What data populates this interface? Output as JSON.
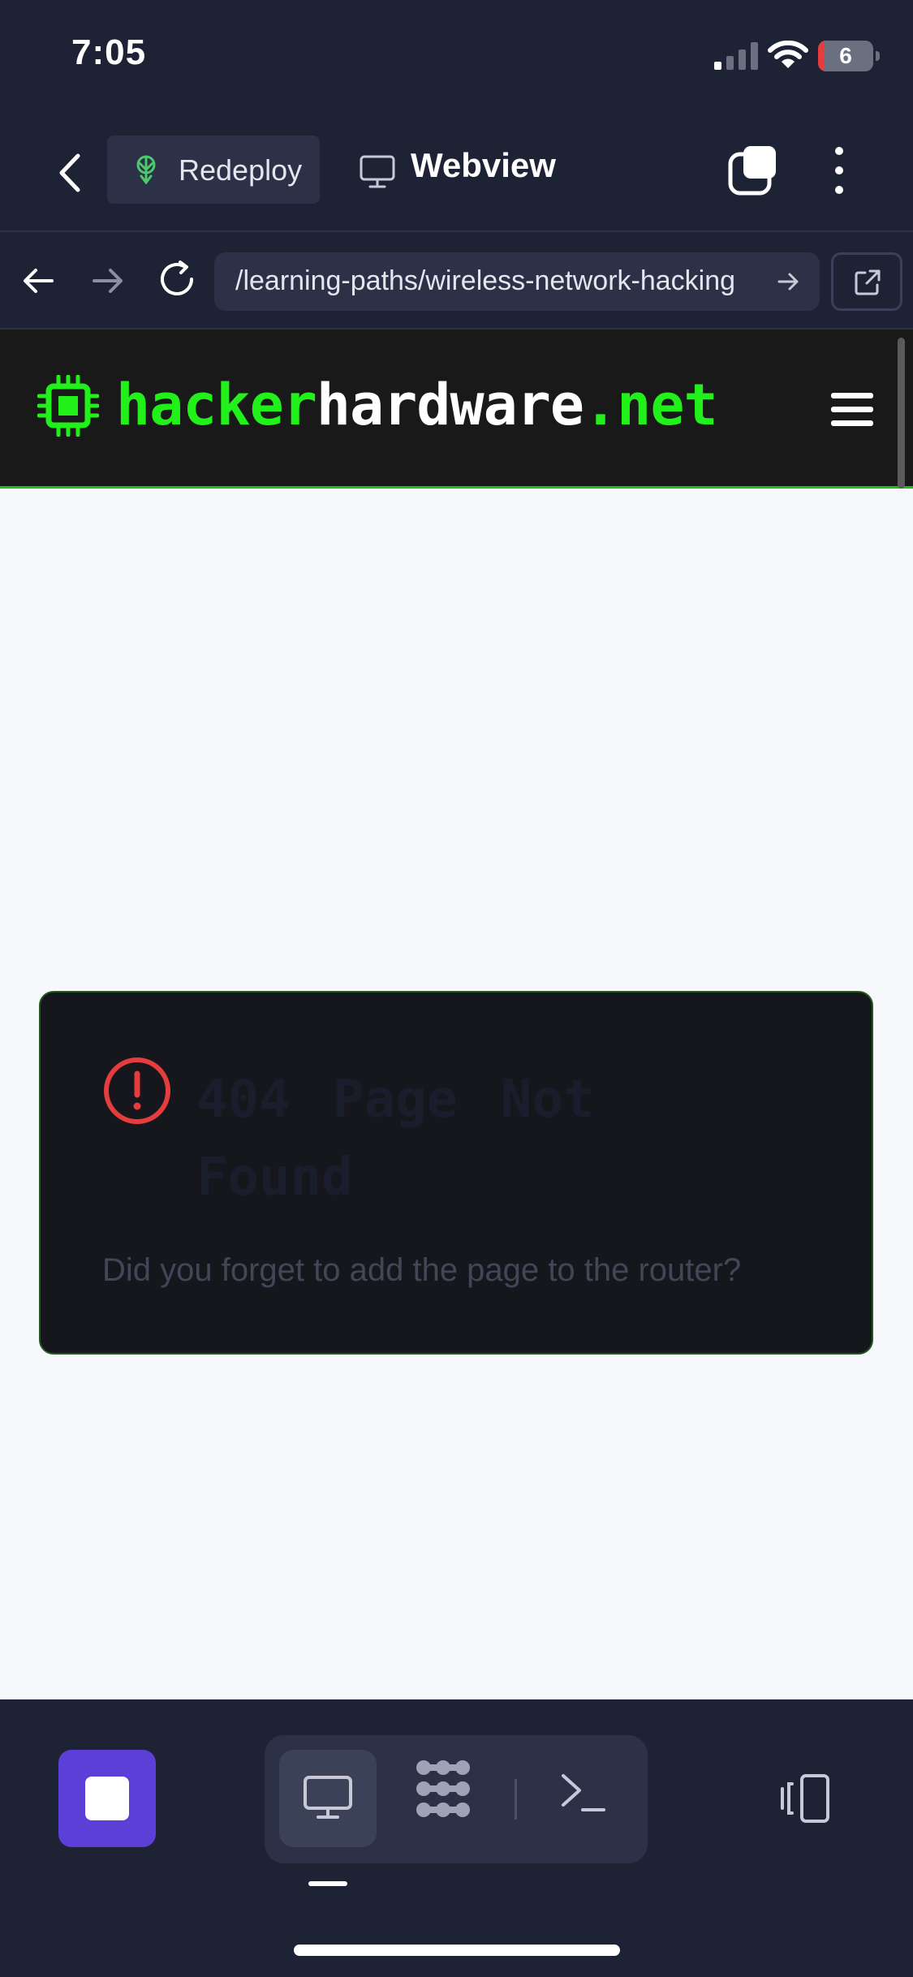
{
  "status_bar": {
    "time": "7:05",
    "battery_level": "6"
  },
  "app_header": {
    "redeploy_label": "Redeploy",
    "webview_label": "Webview"
  },
  "browser": {
    "url": "/learning-paths/wireless-network-hacking"
  },
  "site": {
    "logo_part1": "hacker",
    "logo_part2": "hardware",
    "logo_part3": ".net"
  },
  "error": {
    "title": "404 Page Not Found",
    "message": "Did you forget to add the page to the router?"
  },
  "colors": {
    "accent_green": "#22f01a",
    "stop_purple": "#5b3fd6",
    "error_red": "#e53d3d",
    "chrome_bg": "#1e2235"
  }
}
